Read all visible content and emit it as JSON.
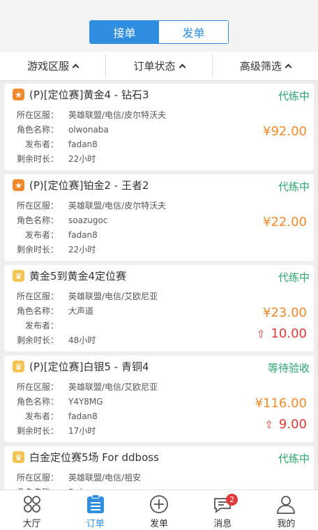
{
  "header": {
    "tabs": [
      {
        "label": "接单",
        "active": true
      },
      {
        "label": "发单",
        "active": false
      }
    ]
  },
  "filters": [
    {
      "label": "游戏区服"
    },
    {
      "label": "订单状态"
    },
    {
      "label": "高级筛选"
    }
  ],
  "labels": {
    "server": "所在区服：",
    "role": "角色名称：",
    "publisher": "发布者：",
    "remaining": "剩余时长："
  },
  "orders": [
    {
      "badge": "orange",
      "title": "(P)[定位赛]黄金4 - 钻石3",
      "status": "代练中",
      "server": "英雄联盟/电信/皮尔特沃夫",
      "role": "olwonaba",
      "publisher": "fadan8",
      "remaining": "22小时",
      "price": "¥92.00",
      "bonus": ""
    },
    {
      "badge": "orange",
      "title": "(P)[定位赛]铂金2 - 王者2",
      "status": "代练中",
      "server": "英雄联盟/电信/皮尔特沃夫",
      "role": "soazugoc",
      "publisher": "fadan8",
      "remaining": "22小时",
      "price": "¥22.00",
      "bonus": ""
    },
    {
      "badge": "gold",
      "title": "黄金5到黄金4定位赛",
      "status": "代练中",
      "server": "英雄联盟/电信/艾欧尼亚",
      "role": "大声道",
      "publisher": "",
      "remaining": "48小时",
      "price": "¥23.00",
      "bonus": "10.00"
    },
    {
      "badge": "gold",
      "title": "(P)[定位赛]白银5 - 青铜4",
      "status": "等待验收",
      "server": "英雄联盟/电信/艾欧尼亚",
      "role": "Y4Y8MG",
      "publisher": "fadan8",
      "remaining": "17小时",
      "price": "¥116.00",
      "bonus": "9.00"
    },
    {
      "badge": "gold",
      "title": "白金定位赛5场 For ddboss",
      "status": "代练中",
      "server": "英雄联盟/电信/祖安",
      "role": "Delacruz",
      "publisher": "",
      "remaining": "",
      "price": "",
      "bonus": ""
    }
  ],
  "tabbar": [
    {
      "label": "大厅",
      "icon": "hall-icon",
      "active": false
    },
    {
      "label": "订单",
      "icon": "order-icon",
      "active": true
    },
    {
      "label": "发单",
      "icon": "plus-circle-icon",
      "active": false
    },
    {
      "label": "消息",
      "icon": "message-icon",
      "active": false,
      "badge": "2"
    },
    {
      "label": "我的",
      "icon": "user-icon",
      "active": false
    }
  ],
  "colors": {
    "accent": "#2f8ee0",
    "status_green": "#2aa36b",
    "price_orange": "#f08a2a",
    "bonus_red": "#e03a3a"
  }
}
